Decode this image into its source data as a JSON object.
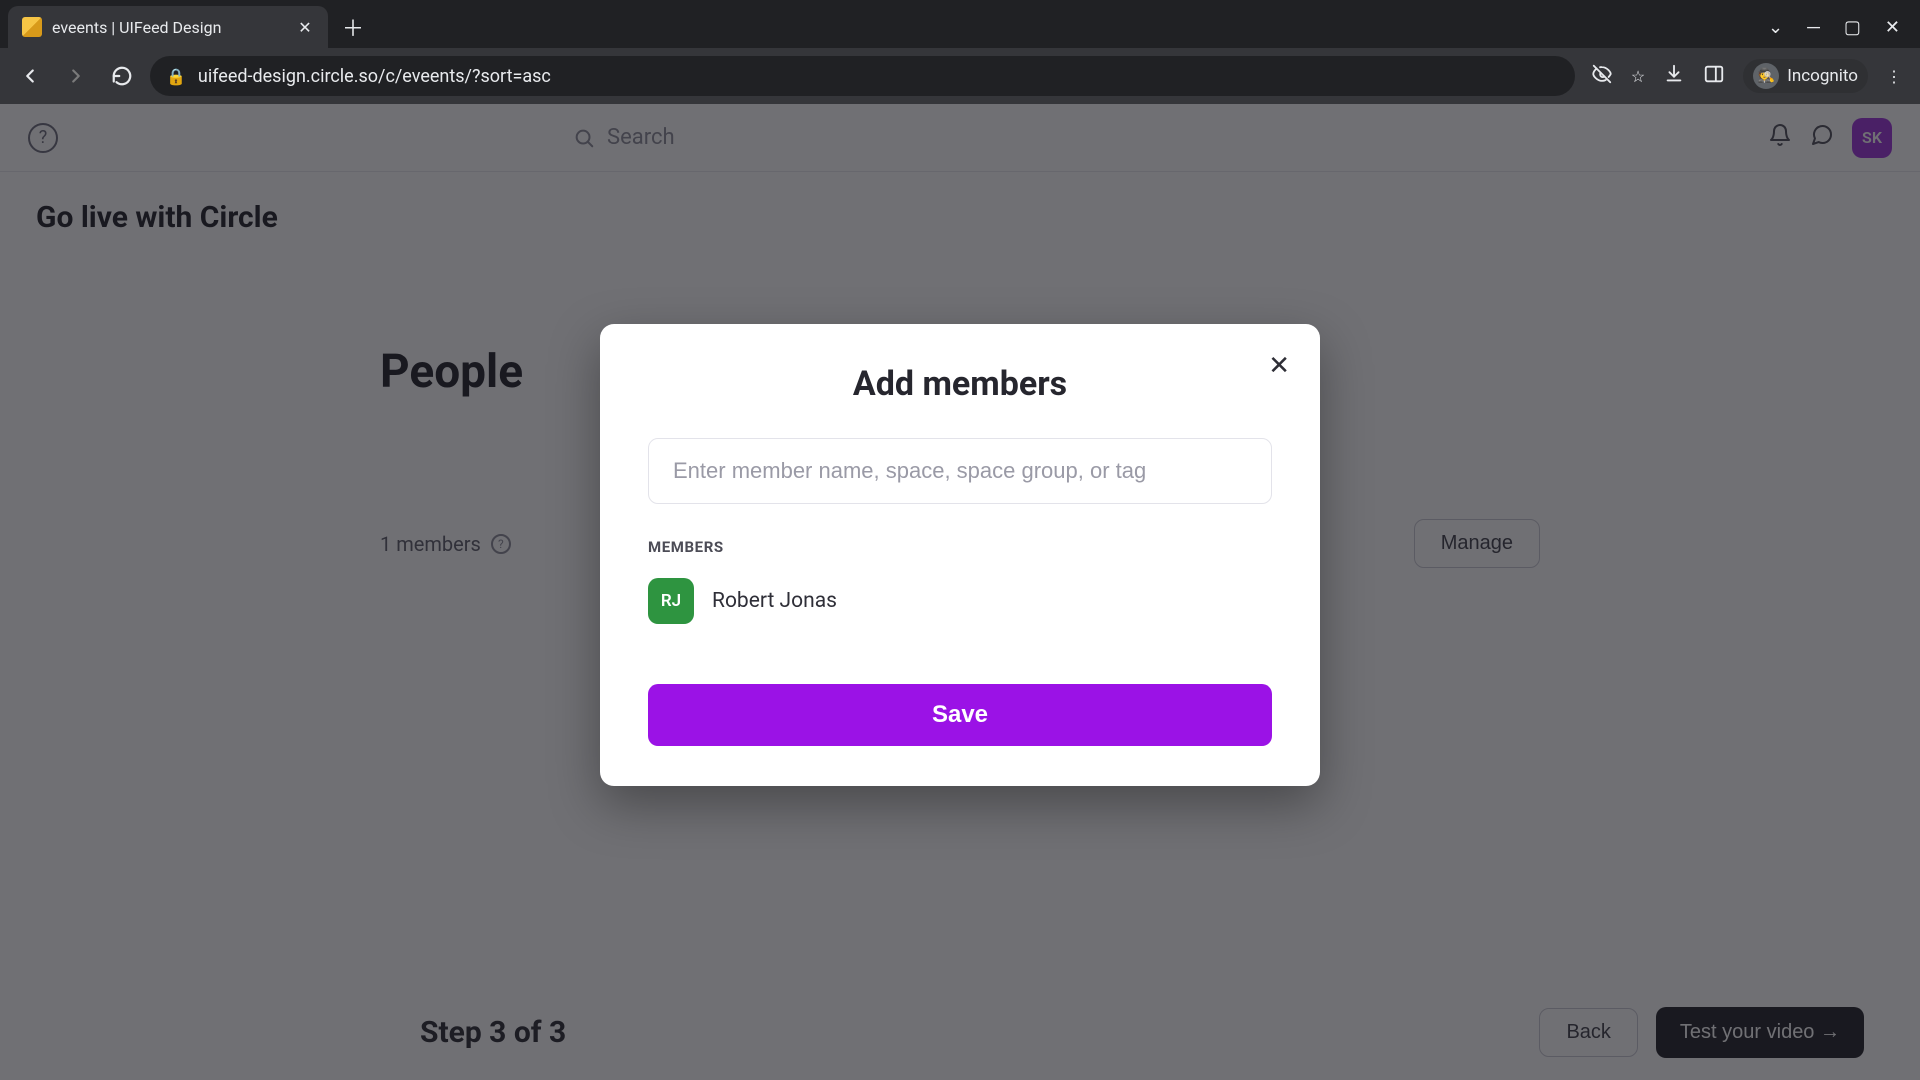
{
  "browser": {
    "tab_title": "eveents | UIFeed Design",
    "url": "uifeed-design.circle.so/c/eveents/?sort=asc",
    "incognito_label": "Incognito"
  },
  "topbar": {
    "search_placeholder": "Search",
    "avatar_initials": "SK"
  },
  "page": {
    "heading": "Go live with Circle",
    "section_title": "People",
    "members_count": "1 members",
    "manage_label": "Manage",
    "step_label": "Step 3 of 3",
    "back_label": "Back",
    "test_label": "Test your video →"
  },
  "modal": {
    "title": "Add members",
    "input_placeholder": "Enter member name, space, space group, or tag",
    "members_label": "MEMBERS",
    "members": [
      {
        "initials": "RJ",
        "name": "Robert Jonas",
        "avatar_color": "#2e9440"
      }
    ],
    "save_label": "Save"
  }
}
